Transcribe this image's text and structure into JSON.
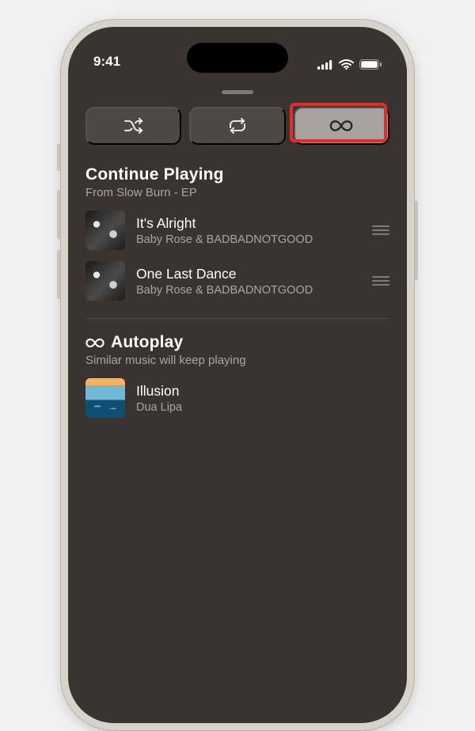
{
  "statusbar": {
    "time": "9:41"
  },
  "playback_controls": {
    "shuffle_icon": "shuffle",
    "repeat_icon": "repeat",
    "autoplay_icon": "infinity",
    "active": "autoplay"
  },
  "highlight": "autoplay-button",
  "sections": {
    "continue": {
      "title": "Continue Playing",
      "subtitle": "From Slow Burn - EP",
      "tracks": [
        {
          "title": "It's Alright",
          "artist": "Baby Rose & BADBADNOTGOOD"
        },
        {
          "title": "One Last Dance",
          "artist": "Baby Rose & BADBADNOTGOOD"
        }
      ]
    },
    "autoplay": {
      "title": "Autoplay",
      "subtitle": "Similar music will keep playing",
      "tracks": [
        {
          "title": "Illusion",
          "artist": "Dua Lipa"
        }
      ]
    }
  }
}
